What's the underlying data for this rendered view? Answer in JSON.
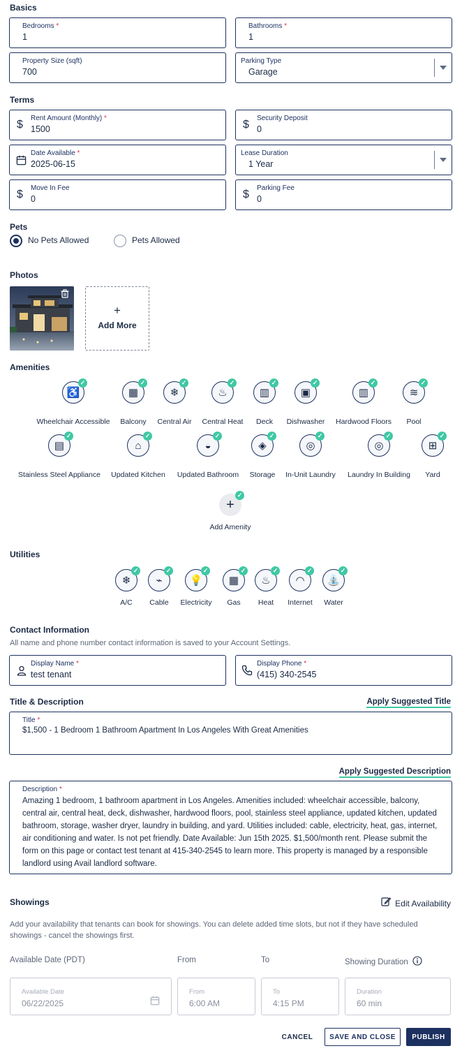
{
  "basics": {
    "title": "Basics",
    "bedrooms": {
      "label": "Bedrooms",
      "value": "1"
    },
    "bathrooms": {
      "label": "Bathrooms",
      "value": "1"
    },
    "property_size": {
      "label": "Property Size (sqft)",
      "value": "700"
    },
    "parking_type": {
      "label": "Parking Type",
      "value": "Garage"
    }
  },
  "terms": {
    "title": "Terms",
    "rent": {
      "label": "Rent Amount (Monthly)",
      "value": "1500",
      "prefix": "$"
    },
    "deposit": {
      "label": "Security Deposit",
      "value": "0",
      "prefix": "$"
    },
    "date_available": {
      "label": "Date Available",
      "value": "2025-06-15"
    },
    "lease_duration": {
      "label": "Lease Duration",
      "value": "1 Year"
    },
    "move_in_fee": {
      "label": "Move In Fee",
      "value": "0",
      "prefix": "$"
    },
    "parking_fee": {
      "label": "Parking Fee",
      "value": "0",
      "prefix": "$"
    }
  },
  "pets": {
    "title": "Pets",
    "options": [
      "No Pets Allowed",
      "Pets Allowed"
    ],
    "selected": "No Pets Allowed"
  },
  "photos": {
    "title": "Photos",
    "add_more_icon": "+",
    "add_more_label": "Add More"
  },
  "amenities": {
    "title": "Amenities",
    "items": [
      {
        "name": "Wheelchair Accessible",
        "icon": "wheelchair-icon",
        "glyph": "♿",
        "selected": true
      },
      {
        "name": "Balcony",
        "icon": "balcony-icon",
        "glyph": "▦",
        "selected": true
      },
      {
        "name": "Central Air",
        "icon": "snowflake-icon",
        "glyph": "❄",
        "selected": true
      },
      {
        "name": "Central Heat",
        "icon": "heater-icon",
        "glyph": "♨",
        "selected": true
      },
      {
        "name": "Deck",
        "icon": "deck-icon",
        "glyph": "▥",
        "selected": true
      },
      {
        "name": "Dishwasher",
        "icon": "dishwasher-icon",
        "glyph": "▣",
        "selected": true
      },
      {
        "name": "Hardwood Floors",
        "icon": "hardwood-icon",
        "glyph": "▥",
        "selected": true
      },
      {
        "name": "Pool",
        "icon": "pool-icon",
        "glyph": "≋",
        "selected": true
      },
      {
        "name": "Stainless Steel Appliance",
        "icon": "appliance-icon",
        "glyph": "▤",
        "selected": true
      },
      {
        "name": "Updated Kitchen",
        "icon": "kitchen-hood-icon",
        "glyph": "⌂",
        "selected": true
      },
      {
        "name": "Updated Bathroom",
        "icon": "toilet-icon",
        "glyph": "◒",
        "selected": true
      },
      {
        "name": "Storage",
        "icon": "storage-icon",
        "glyph": "◈",
        "selected": true
      },
      {
        "name": "In-Unit Laundry",
        "icon": "washer-icon",
        "glyph": "◎",
        "selected": true
      },
      {
        "name": "Laundry In Building",
        "icon": "washer-building-icon",
        "glyph": "◎",
        "selected": true
      },
      {
        "name": "Yard",
        "icon": "fence-icon",
        "glyph": "⊞",
        "selected": true
      }
    ],
    "add_label": "Add Amenity",
    "add_glyph": "+"
  },
  "utilities": {
    "title": "Utilities",
    "items": [
      {
        "name": "A/C",
        "icon": "snowflake-icon",
        "glyph": "❄"
      },
      {
        "name": "Cable",
        "icon": "cable-icon",
        "glyph": "⌁"
      },
      {
        "name": "Electricity",
        "icon": "lightbulb-icon",
        "glyph": "💡"
      },
      {
        "name": "Gas",
        "icon": "gas-meter-icon",
        "glyph": "▦"
      },
      {
        "name": "Heat",
        "icon": "heater-icon",
        "glyph": "♨"
      },
      {
        "name": "Internet",
        "icon": "wifi-icon",
        "glyph": "◠"
      },
      {
        "name": "Water",
        "icon": "faucet-icon",
        "glyph": "⛲"
      }
    ]
  },
  "contact": {
    "title": "Contact Information",
    "note": "All name and phone number contact information is saved to your Account Settings.",
    "display_name": {
      "label": "Display Name",
      "value": "test tenant"
    },
    "display_phone": {
      "label": "Display Phone",
      "value": "(415) 340-2545"
    }
  },
  "title_desc": {
    "title": "Title & Description",
    "apply_title": "Apply Suggested Title",
    "title_field": {
      "label": "Title",
      "value": "$1,500 - 1 Bedroom 1 Bathroom Apartment In Los Angeles With Great Amenities"
    },
    "apply_description": "Apply Suggested Description",
    "description_field": {
      "label": "Description",
      "value": "Amazing 1 bedroom, 1 bathroom apartment in Los Angeles. Amenities included: wheelchair accessible, balcony, central air, central heat, deck, dishwasher, hardwood floors, pool, stainless steel appliance, updated kitchen, updated bathroom, storage, washer dryer, laundry in building, and yard. Utilities included: cable, electricity, heat, gas, internet, air conditioning and water. Is not pet friendly. Date Available: Jun 15th 2025. $1,500/month rent. Please submit the form on this page or contact test tenant at 415-340-2545 to learn more. This property is managed by a responsible landlord using Avail landlord software."
    }
  },
  "showings": {
    "title": "Showings",
    "edit_availability": "Edit Availability",
    "note": "Add your availability that tenants can book for showings. You can delete added time slots, but not if they have scheduled showings - cancel the showings first.",
    "headers": {
      "date": "Available Date (PDT)",
      "from": "From",
      "to": "To",
      "duration": "Showing Duration"
    },
    "date_field": {
      "label": "Available Date",
      "value": "06/22/2025"
    },
    "from_field": {
      "label": "From",
      "value": "6:00 AM"
    },
    "to_field": {
      "label": "To",
      "value": "4:15 PM"
    },
    "duration_field": {
      "label": "Duration",
      "value": "60 min"
    }
  },
  "actions": {
    "cancel": "CANCEL",
    "save_close": "SAVE AND CLOSE",
    "publish": "PUBLISH"
  },
  "colors": {
    "primary": "#1d3160",
    "accent_green": "#3fc8a4",
    "required": "#d9324a"
  }
}
